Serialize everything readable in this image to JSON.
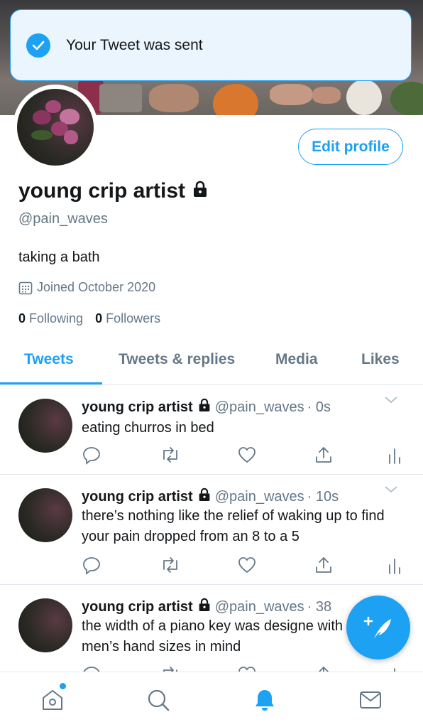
{
  "toast": {
    "message": "Your Tweet was sent",
    "icon": "check-circle-icon"
  },
  "profile": {
    "name": "young crip artist",
    "handle": "@pain_waves",
    "bio": "taking a bath",
    "joined": "Joined October 2020",
    "following_count": "0",
    "following_label": "Following",
    "followers_count": "0",
    "followers_label": "Followers",
    "edit_button": "Edit profile",
    "protected": true
  },
  "tabs": [
    {
      "label": "Tweets",
      "active": true
    },
    {
      "label": "Tweets & replies",
      "active": false
    },
    {
      "label": "Media",
      "active": false
    },
    {
      "label": "Likes",
      "active": false
    }
  ],
  "tweets": [
    {
      "name": "young crip artist",
      "handle": "@pain_waves",
      "time": "· 0s",
      "text": "eating churros in bed"
    },
    {
      "name": "young crip artist",
      "handle": "@pain_waves",
      "time": "· 10s",
      "text": "there’s nothing like the relief of waking up to find your pain dropped from an 8 to a 5"
    },
    {
      "name": "young crip artist",
      "handle": "@pain_waves",
      "time": "· 38",
      "text": "the width of a piano key was designe with men’s hand sizes in mind"
    }
  ],
  "nav": [
    "home-icon",
    "search-icon",
    "notifications-icon",
    "messages-icon"
  ],
  "colors": {
    "accent": "#1da1f2",
    "text": "#14171a",
    "muted": "#657786",
    "border": "#e1e8ed"
  }
}
